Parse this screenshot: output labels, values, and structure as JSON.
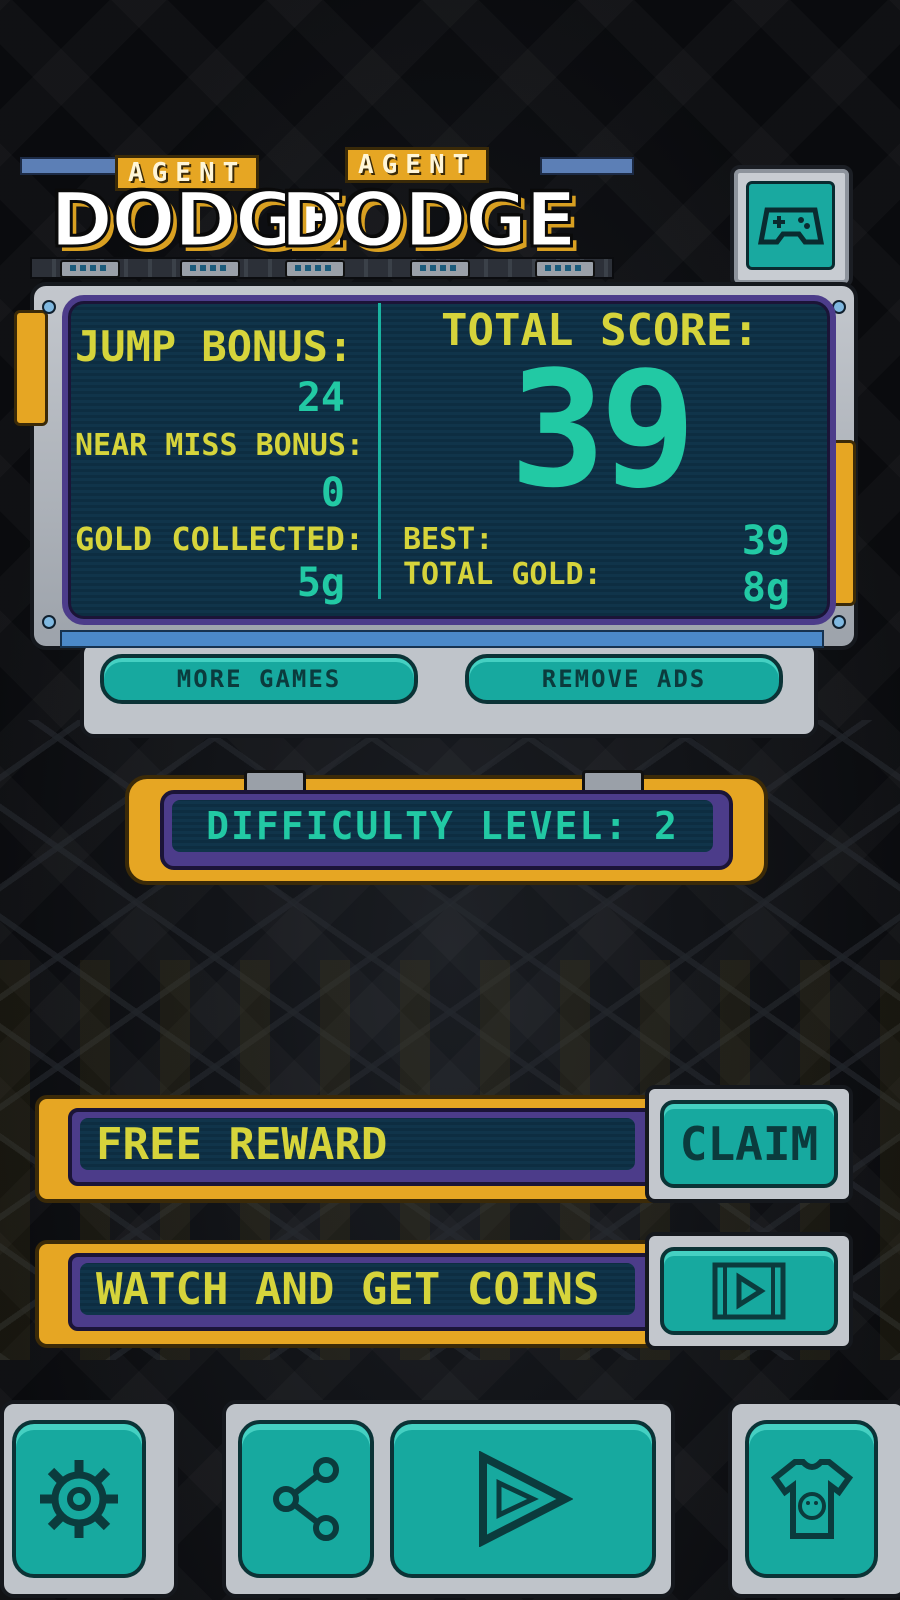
{
  "logo": {
    "subtitle_left": "AGENT",
    "subtitle_right": "AGENT",
    "title_left": "DODGE",
    "title_right": "DODGE"
  },
  "stats": {
    "jump_bonus_label": "JUMP BONUS:",
    "jump_bonus_value": "24",
    "near_miss_label": "NEAR MISS BONUS:",
    "near_miss_value": "0",
    "gold_collected_label": "GOLD COLLECTED:",
    "gold_collected_value": "5g",
    "total_score_label": "TOTAL SCORE:",
    "total_score_value": "39",
    "best_label": "BEST:",
    "best_value": "39",
    "total_gold_label": "TOTAL GOLD:",
    "total_gold_value": "8g"
  },
  "panel_buttons": {
    "more_games": "MORE GAMES",
    "remove_ads": "REMOVE ADS"
  },
  "difficulty": {
    "label": "DIFFICULTY LEVEL: 2"
  },
  "rewards": {
    "free_reward_label": "FREE REWARD",
    "claim_button": "CLAIM",
    "watch_label": "WATCH AND GET COINS"
  },
  "icons": {
    "gamepad": "gamepad-icon",
    "video": "video-play-icon",
    "settings": "gear-icon",
    "share": "share-icon",
    "play": "play-icon",
    "shop": "shirt-icon"
  },
  "colors": {
    "gold_frame": "#e6a623",
    "teal_button": "#17a99f",
    "teal_text": "#22c9a4",
    "yellow_text": "#d6d43b",
    "screen_bg": "#0d2d41",
    "purple_bezel": "#4c3c8a"
  }
}
